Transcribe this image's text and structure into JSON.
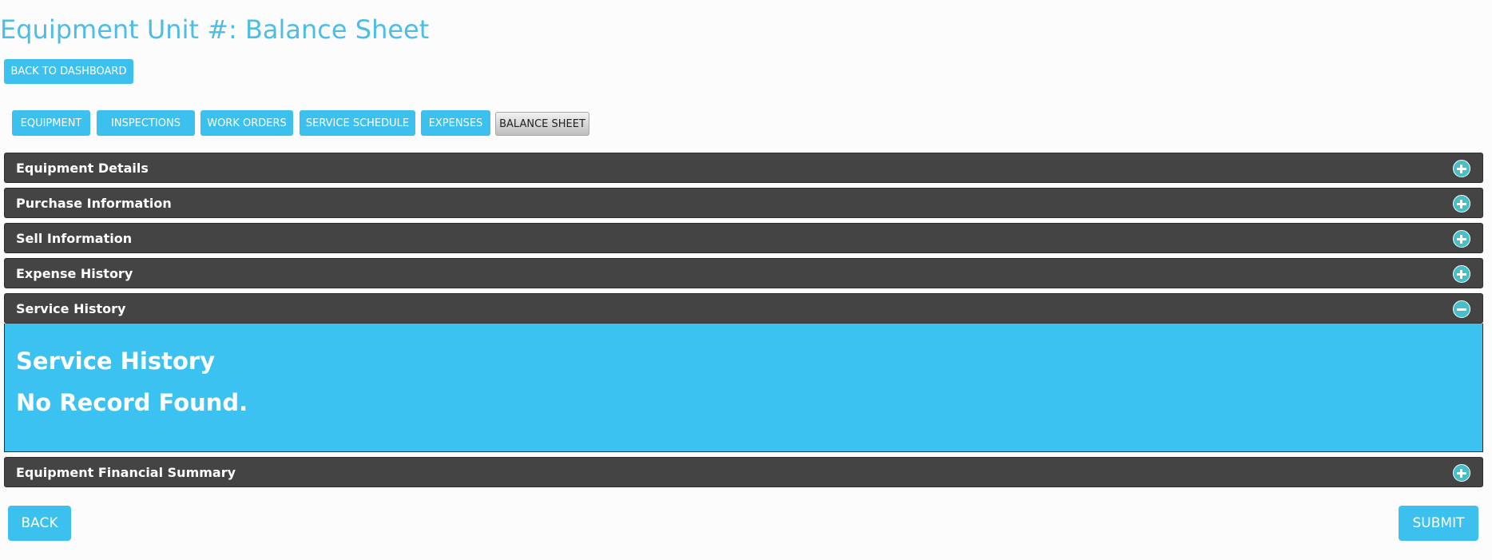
{
  "page": {
    "title": "Equipment Unit #: Balance Sheet",
    "back_to_dashboard_label": "BACK TO DASHBOARD"
  },
  "tabs": [
    {
      "label": "EQUIPMENT",
      "active": false
    },
    {
      "label": "INSPECTIONS",
      "active": false
    },
    {
      "label": "WORK ORDERS",
      "active": false
    },
    {
      "label": "SERVICE SCHEDULE",
      "active": false
    },
    {
      "label": "EXPENSES",
      "active": false
    },
    {
      "label": "BALANCE SHEET",
      "active": true
    }
  ],
  "sections": [
    {
      "label": "Equipment Details",
      "expanded": false,
      "icon": "plus-icon"
    },
    {
      "label": "Purchase Information",
      "expanded": false,
      "icon": "plus-icon"
    },
    {
      "label": "Sell Information",
      "expanded": false,
      "icon": "plus-icon"
    },
    {
      "label": "Expense History",
      "expanded": false,
      "icon": "plus-icon"
    },
    {
      "label": "Service History",
      "expanded": true,
      "icon": "minus-icon"
    },
    {
      "label": "Equipment Financial Summary",
      "expanded": false,
      "icon": "plus-icon"
    }
  ],
  "service_history_panel": {
    "heading": "Service History",
    "message": "No Record Found."
  },
  "footer": {
    "back_label": "BACK",
    "submit_label": "SUBMIT"
  },
  "colors": {
    "accent": "#3cc1ef",
    "title": "#4dbde6",
    "section_header": "#444444",
    "icon": "#45c0c8"
  }
}
